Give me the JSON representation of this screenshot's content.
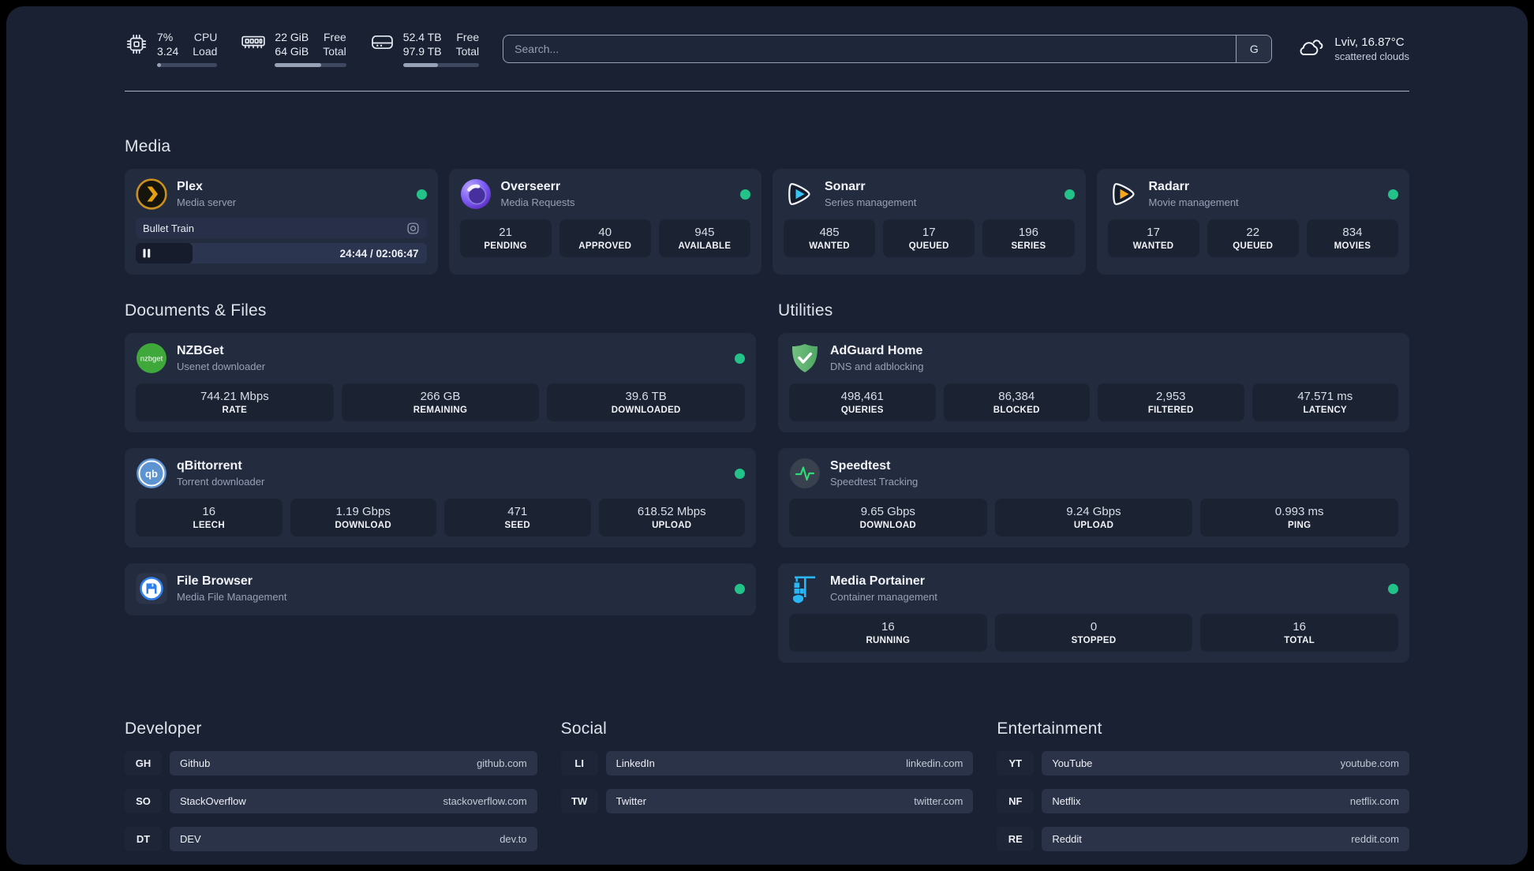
{
  "colors": {
    "status_online": "#23C289",
    "page_bg": "#1A2133",
    "card_bg": "#232B3F"
  },
  "topbar": {
    "system": [
      {
        "id": "cpu",
        "icon": "cpu-icon",
        "values": [
          "7%",
          "3.24"
        ],
        "labels": [
          "CPU",
          "Load"
        ],
        "progress_pct": 7
      },
      {
        "id": "ram",
        "icon": "ram-icon",
        "values": [
          "22 GiB",
          "64 GiB"
        ],
        "labels": [
          "Free",
          "Total"
        ],
        "progress_pct": 65
      },
      {
        "id": "disk",
        "icon": "disk-icon",
        "values": [
          "52.4 TB",
          "97.9 TB"
        ],
        "labels": [
          "Free",
          "Total"
        ],
        "progress_pct": 46
      }
    ],
    "search": {
      "placeholder": "Search...",
      "engine_button": "G"
    },
    "weather": {
      "icon": "scattered-clouds-icon",
      "location": "Lviv, 16.87°C",
      "condition": "scattered clouds"
    }
  },
  "media_section": {
    "title": "Media",
    "apps": [
      {
        "id": "plex",
        "icon": "plex-icon",
        "name": "Plex",
        "subtitle": "Media server",
        "online": true,
        "media": {
          "title": "Bullet Train",
          "time": "24:44 / 02:06:47",
          "progress_pct": 19.5
        }
      },
      {
        "id": "overseerr",
        "icon": "overseerr-icon",
        "name": "Overseerr",
        "subtitle": "Media Requests",
        "online": true,
        "stats": [
          {
            "value": "21",
            "label": "PENDING"
          },
          {
            "value": "40",
            "label": "APPROVED"
          },
          {
            "value": "945",
            "label": "AVAILABLE"
          }
        ]
      },
      {
        "id": "sonarr",
        "icon": "sonarr-icon",
        "name": "Sonarr",
        "subtitle": "Series management",
        "online": true,
        "stats": [
          {
            "value": "485",
            "label": "WANTED"
          },
          {
            "value": "17",
            "label": "QUEUED"
          },
          {
            "value": "196",
            "label": "SERIES"
          }
        ]
      },
      {
        "id": "radarr",
        "icon": "radarr-icon",
        "name": "Radarr",
        "subtitle": "Movie management",
        "online": true,
        "stats": [
          {
            "value": "17",
            "label": "WANTED"
          },
          {
            "value": "22",
            "label": "QUEUED"
          },
          {
            "value": "834",
            "label": "MOVIES"
          }
        ]
      }
    ]
  },
  "documents_section": {
    "title": "Documents & Files",
    "apps": [
      {
        "id": "nzbget",
        "icon": "nzbget-icon",
        "name": "NZBGet",
        "subtitle": "Usenet downloader",
        "online": true,
        "stats": [
          {
            "value": "744.21 Mbps",
            "label": "RATE"
          },
          {
            "value": "266 GB",
            "label": "REMAINING"
          },
          {
            "value": "39.6 TB",
            "label": "DOWNLOADED"
          }
        ]
      },
      {
        "id": "qbittorrent",
        "icon": "qbittorrent-icon",
        "name": "qBittorrent",
        "subtitle": "Torrent downloader",
        "online": true,
        "stats": [
          {
            "value": "16",
            "label": "LEECH"
          },
          {
            "value": "1.19 Gbps",
            "label": "DOWNLOAD"
          },
          {
            "value": "471",
            "label": "SEED"
          },
          {
            "value": "618.52 Mbps",
            "label": "UPLOAD"
          }
        ]
      },
      {
        "id": "filebrowser",
        "icon": "filebrowser-icon",
        "name": "File Browser",
        "subtitle": "Media File Management",
        "online": true
      }
    ]
  },
  "utilities_section": {
    "title": "Utilities",
    "apps": [
      {
        "id": "adguard",
        "icon": "adguard-icon",
        "name": "AdGuard Home",
        "subtitle": "DNS and adblocking",
        "online": false,
        "stats": [
          {
            "value": "498,461",
            "label": "QUERIES"
          },
          {
            "value": "86,384",
            "label": "BLOCKED"
          },
          {
            "value": "2,953",
            "label": "FILTERED"
          },
          {
            "value": "47.571 ms",
            "label": "LATENCY"
          }
        ]
      },
      {
        "id": "speedtest",
        "icon": "speedtest-icon",
        "name": "Speedtest",
        "subtitle": "Speedtest Tracking",
        "online": false,
        "stats": [
          {
            "value": "9.65 Gbps",
            "label": "DOWNLOAD"
          },
          {
            "value": "9.24 Gbps",
            "label": "UPLOAD"
          },
          {
            "value": "0.993 ms",
            "label": "PING"
          }
        ]
      },
      {
        "id": "portainer",
        "icon": "portainer-icon",
        "name": "Media Portainer",
        "subtitle": "Container management",
        "online": true,
        "stats": [
          {
            "value": "16",
            "label": "RUNNING"
          },
          {
            "value": "0",
            "label": "STOPPED"
          },
          {
            "value": "16",
            "label": "TOTAL"
          }
        ]
      }
    ]
  },
  "link_sections": [
    {
      "title": "Developer",
      "links": [
        {
          "abbr": "GH",
          "name": "Github",
          "url": "github.com"
        },
        {
          "abbr": "SO",
          "name": "StackOverflow",
          "url": "stackoverflow.com"
        },
        {
          "abbr": "DT",
          "name": "DEV",
          "url": "dev.to"
        }
      ]
    },
    {
      "title": "Social",
      "links": [
        {
          "abbr": "LI",
          "name": "LinkedIn",
          "url": "linkedin.com"
        },
        {
          "abbr": "TW",
          "name": "Twitter",
          "url": "twitter.com"
        }
      ]
    },
    {
      "title": "Entertainment",
      "links": [
        {
          "abbr": "YT",
          "name": "YouTube",
          "url": "youtube.com"
        },
        {
          "abbr": "NF",
          "name": "Netflix",
          "url": "netflix.com"
        },
        {
          "abbr": "RE",
          "name": "Reddit",
          "url": "reddit.com"
        }
      ]
    }
  ]
}
